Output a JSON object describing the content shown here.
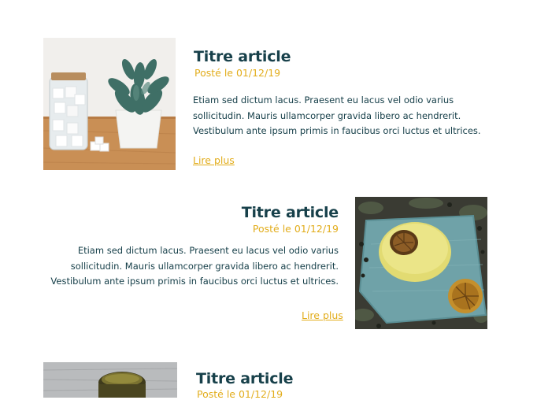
{
  "articles": [
    {
      "title": "Titre article",
      "date": "Posté le 01/12/19",
      "excerpt": [
        "Etiam sed dictum lacus. Praesent eu lacus vel odio varius",
        "sollicitudin. Mauris ullamcorper gravida libero ac hendrerit.",
        "Vestibulum ante ipsum primis in faucibus orci luctus et ultrices."
      ],
      "read_more": "Lire plus",
      "image": "sugar-jar-succulent-photo"
    },
    {
      "title": "Titre article",
      "date": "Posté le 01/12/19",
      "excerpt": [
        "Etiam sed dictum lacus. Praesent eu lacus vel odio varius",
        "sollicitudin. Mauris ullamcorper gravida libero ac hendrerit.",
        "Vestibulum ante ipsum primis in faucibus orci luctus et ultrices."
      ],
      "read_more": "Lire plus",
      "image": "soap-bar-dried-lemon-photo"
    },
    {
      "title": "Titre article",
      "date": "Posté le 01/12/19",
      "image": "jar-lid-photo"
    }
  ],
  "colors": {
    "title": "#17404a",
    "accent": "#e2ad1c",
    "text": "#17404a"
  }
}
